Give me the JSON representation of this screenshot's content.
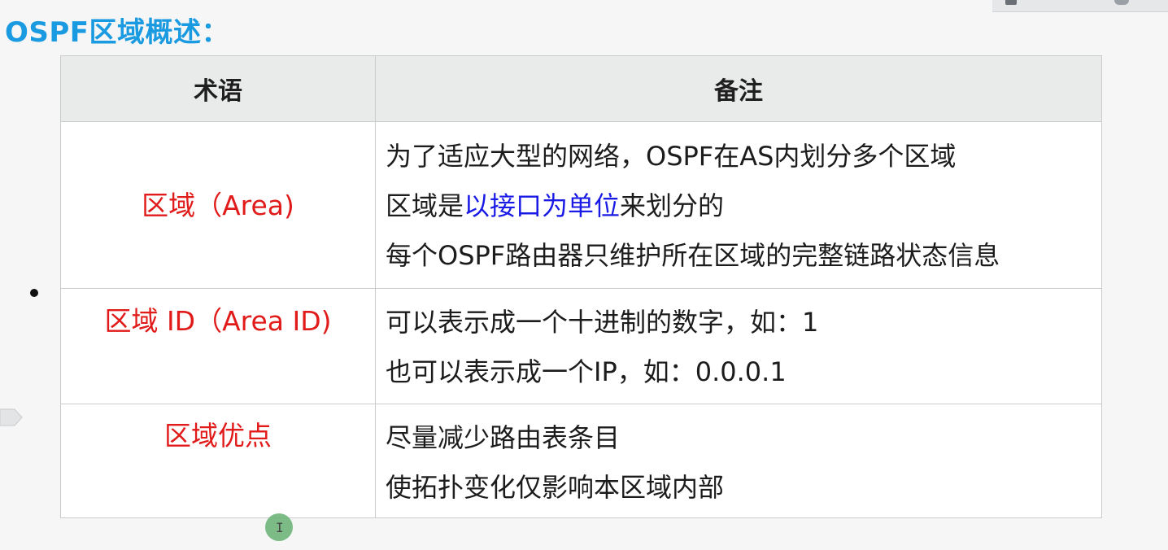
{
  "title": "OSPF区域概述：",
  "table": {
    "headers": {
      "term": "术语",
      "note": "备注"
    },
    "rows": [
      {
        "term": "区域（Area)",
        "notes": [
          {
            "text": "为了适应大型的网络，OSPF在AS内划分多个区域"
          },
          {
            "prefix": "区域是",
            "highlight": "以接口为单位",
            "suffix": "来划分的"
          },
          {
            "text": "每个OSPF路由器只维护所在区域的完整链路状态信息"
          }
        ]
      },
      {
        "term": "区域 ID（Area ID)",
        "notes": [
          {
            "text": "可以表示成一个十进制的数字，如：1"
          },
          {
            "text": "也可以表示成一个IP，如：0.0.0.1"
          }
        ]
      },
      {
        "term": "区域优点",
        "notes": [
          {
            "text": "尽量减少路由表条目"
          },
          {
            "text": "使拓扑变化仅影响本区域内部"
          }
        ]
      }
    ]
  },
  "cursor": {
    "glyph": "I"
  },
  "colors": {
    "title": "#1a9ae0",
    "term": "#e11a1a",
    "highlight": "#1a1ae6",
    "header_bg": "#e9eaea"
  },
  "icons": {
    "bullet": "bullet-dot",
    "side_tab": "side-tab-arrow-icon",
    "cursor": "text-cursor-icon"
  }
}
